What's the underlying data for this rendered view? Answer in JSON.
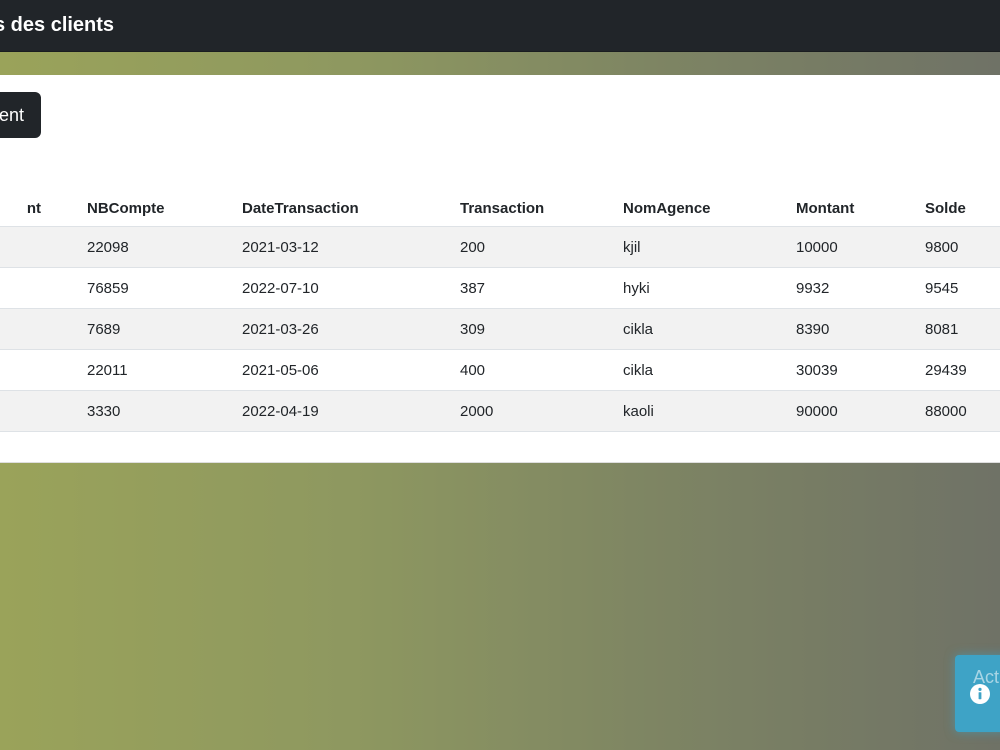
{
  "header": {
    "title": "s des clients"
  },
  "toolbar": {
    "button_label": "ent"
  },
  "table": {
    "columns": [
      "nt",
      "NBCompte",
      "DateTransaction",
      "Transaction",
      "NomAgence",
      "Montant",
      "Solde"
    ],
    "rows": [
      [
        "",
        "22098",
        "2021-03-12",
        "200",
        "kjil",
        "10000",
        "9800"
      ],
      [
        "",
        "76859",
        "2022-07-10",
        "387",
        "hyki",
        "9932",
        "9545"
      ],
      [
        "",
        "7689",
        "2021-03-26",
        "309",
        "cikla",
        "8390",
        "8081"
      ],
      [
        "",
        "22011",
        "2021-05-06",
        "400",
        "cikla",
        "30039",
        "29439"
      ],
      [
        "",
        "3330",
        "2022-04-19",
        "2000",
        "kaoli",
        "90000",
        "88000"
      ]
    ]
  },
  "widget": {
    "text": "Act",
    "icon": "info-icon"
  },
  "colors": {
    "topbar": "#212529",
    "button": "#212529",
    "stripe": "#f2f2f2",
    "widget": "#3ea3c6",
    "gradient_left": "#9aa35a",
    "gradient_right": "#6f7266"
  }
}
